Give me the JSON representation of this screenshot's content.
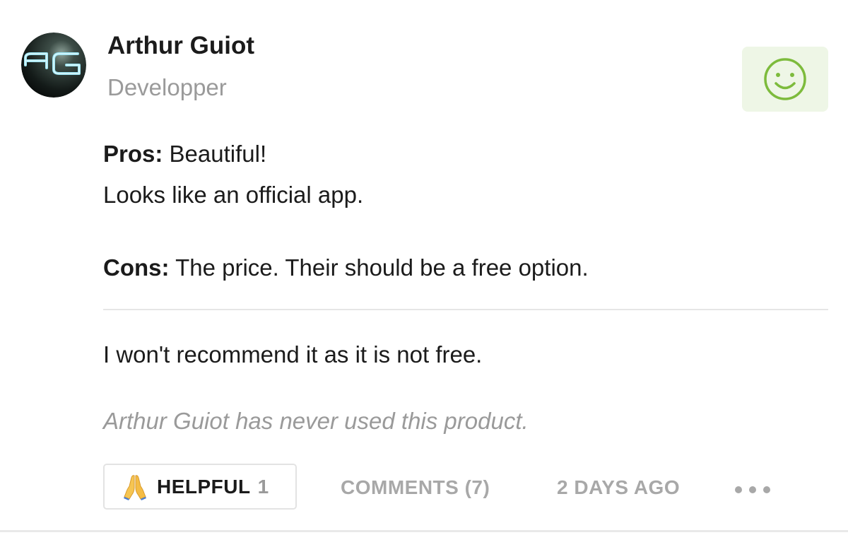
{
  "author": {
    "name": "Arthur Guiot",
    "role": "Developper",
    "avatar_icon": "ag-monogram-avatar"
  },
  "sentiment": {
    "icon": "smiley-face-icon",
    "color": "#7dbb3c",
    "background": "#eef6e6"
  },
  "review": {
    "pros_label": "Pros:",
    "pros_text": " Beautiful!",
    "pros_text_2": "Looks like an official app.",
    "cons_label": "Cons:",
    "cons_text": " The price. Their should be a free option.",
    "comment": "I won't recommend it as it is not free.",
    "usage_note": "Arthur Guiot has never used this product."
  },
  "actions": {
    "helpful_icon": "folded-hands-icon",
    "helpful_label": "HELPFUL",
    "helpful_count": "1",
    "comments_label": "COMMENTS (7)",
    "date_label": "2 DAYS AGO",
    "more_icon": "ellipsis-icon"
  }
}
